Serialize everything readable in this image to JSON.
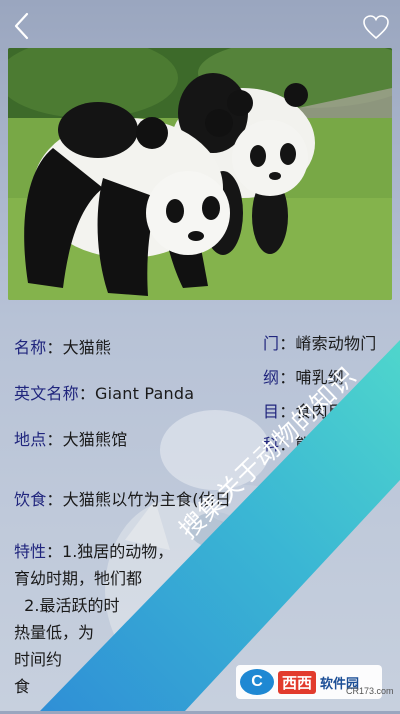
{
  "topbar": {
    "back_icon": "chevron-left-icon",
    "favorite_icon": "heart-outline-icon"
  },
  "hero": {
    "alt": "大熊猫"
  },
  "info": {
    "left": [
      {
        "key": "名称",
        "sep": "：",
        "value": "大猫熊"
      },
      {
        "key": "英文名称",
        "sep": "：",
        "value": "Giant Panda"
      },
      {
        "key": "地点",
        "sep": "：",
        "value": "大猫熊馆"
      },
      {
        "key": "饮食",
        "sep": "：",
        "value": "大猫熊以竹为主食(估日"
      }
    ],
    "right": [
      {
        "key": "门",
        "sep": "：",
        "value": "嵴索动物门"
      },
      {
        "key": "纲",
        "sep": "：",
        "value": "哺乳纲"
      },
      {
        "key": "目",
        "sep": "：",
        "value": "食肉目"
      },
      {
        "key": "科",
        "sep": "：",
        "value": "熊"
      }
    ],
    "traits": {
      "key": "特性",
      "sep": "：",
      "lines": [
        "1.独居的动物，",
        "育幼时期，牠们都",
        "  2.最活跃的时",
        "热量低，为",
        "时间约",
        "食"
      ]
    }
  },
  "banner": {
    "text": "搜集关于动物的知识",
    "color": "#44c6cf"
  },
  "watermark": {
    "logo": "C",
    "brand": "西西",
    "name": "软件园",
    "domain": "CR173.com"
  }
}
